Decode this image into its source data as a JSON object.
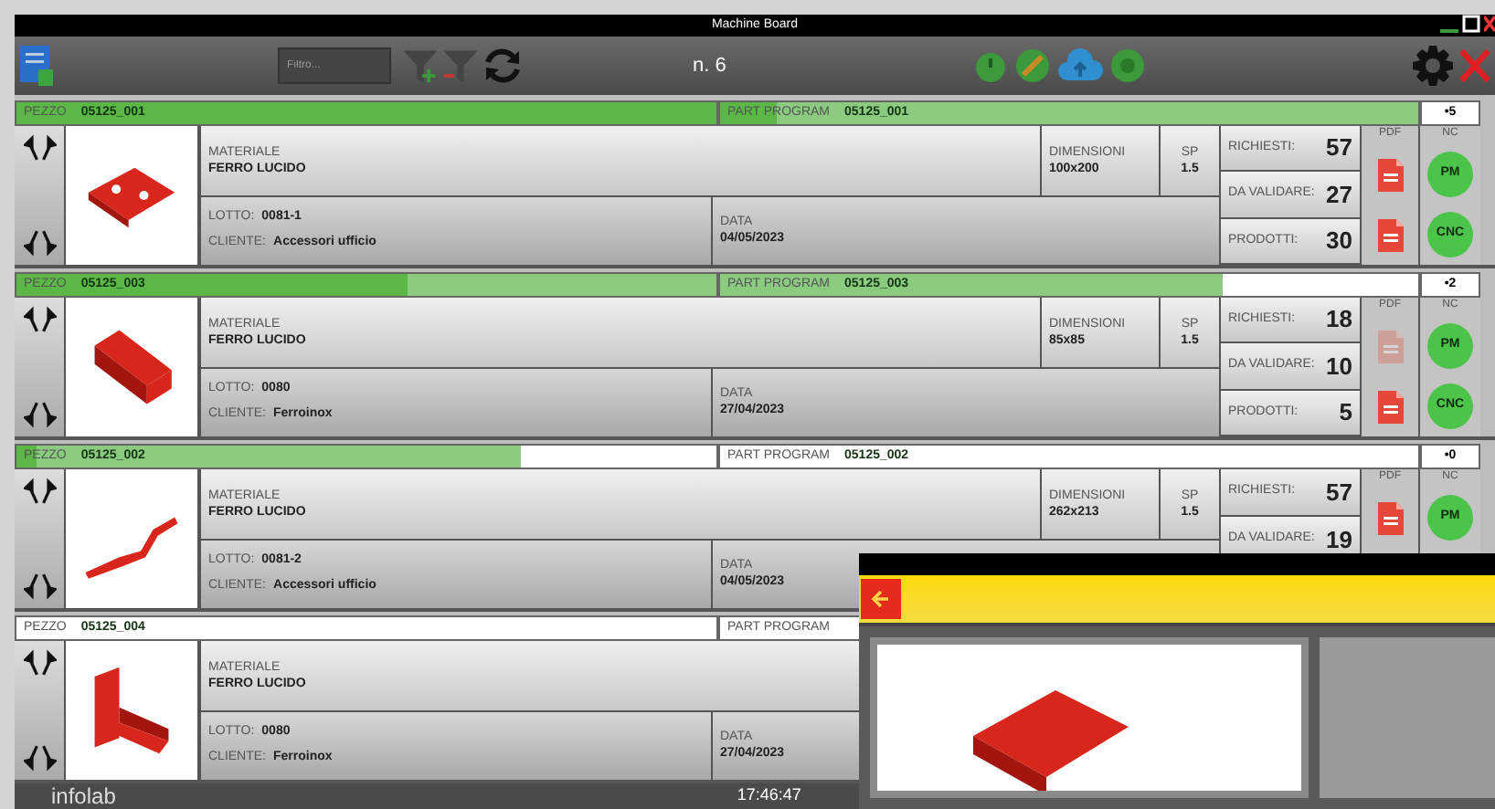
{
  "window": {
    "title": "Machine Board"
  },
  "toolbar": {
    "search": {
      "placeholder": "Filtro..."
    },
    "count": "n. 6"
  },
  "cards": [
    {
      "pezzo": {
        "label": "PEZZO",
        "code": "05125_001",
        "level": 1,
        "inner": {
          "level": 1
        }
      },
      "program": {
        "label": "PART PROGRAM",
        "code": "05125_001",
        "level": 1,
        "inner": {
          "level": 0.08
        }
      },
      "counter": "•5",
      "part": {
        "kind": "plate"
      },
      "materiale": {
        "label": "MATERIALE",
        "value": "FERRO LUCIDO"
      },
      "lotto": {
        "label": "LOTTO:",
        "value": "0081-1"
      },
      "cliente": {
        "label": "CLIENTE:",
        "value": "Accessori ufficio"
      },
      "data": {
        "label": "DATA",
        "value": "04/05/2023"
      },
      "dimensioni": {
        "label": "DIMENSIONI",
        "value": "100x200"
      },
      "sp": {
        "label": "SP",
        "value": "1.5"
      },
      "counts": [
        {
          "label": "RICHIESTI:",
          "value": "57"
        },
        {
          "label": "DA VALIDARE:",
          "value": "27"
        },
        {
          "label": "PRODOTTI:",
          "value": "30"
        }
      ],
      "pdf": {
        "label": "PDF",
        "files": [
          {
            "disabled": false
          },
          {
            "disabled": false
          }
        ]
      },
      "nc": {
        "label": "NC",
        "buttons": [
          "PM",
          "CNC"
        ]
      }
    },
    {
      "pezzo": {
        "label": "PEZZO",
        "code": "05125_003",
        "level": 1,
        "inner": {
          "level": 0.56
        }
      },
      "program": {
        "label": "PART PROGRAM",
        "code": "05125_003",
        "level": 0.72,
        "inner": {
          "level": 0
        }
      },
      "counter": "•2",
      "part": {
        "kind": "channel"
      },
      "materiale": {
        "label": "MATERIALE",
        "value": "FERRO LUCIDO"
      },
      "lotto": {
        "label": "LOTTO:",
        "value": "0080"
      },
      "cliente": {
        "label": "CLIENTE:",
        "value": "Ferroinox"
      },
      "data": {
        "label": "DATA",
        "value": "27/04/2023"
      },
      "dimensioni": {
        "label": "DIMENSIONI",
        "value": "85x85"
      },
      "sp": {
        "label": "SP",
        "value": "1.5"
      },
      "counts": [
        {
          "label": "RICHIESTI:",
          "value": "18"
        },
        {
          "label": "DA VALIDARE:",
          "value": "10"
        },
        {
          "label": "PRODOTTI:",
          "value": "5"
        }
      ],
      "pdf": {
        "label": "PDF",
        "files": [
          {
            "disabled": true
          },
          {
            "disabled": false
          }
        ]
      },
      "nc": {
        "label": "NC",
        "buttons": [
          "PM",
          "CNC"
        ]
      }
    },
    {
      "pezzo": {
        "label": "PEZZO",
        "code": "05125_002",
        "level": 0.72,
        "inner": {
          "level": 0.03
        }
      },
      "program": {
        "label": "PART PROGRAM",
        "code": "05125_002",
        "level": 0,
        "inner": {
          "level": 0
        }
      },
      "counter": "•0",
      "part": {
        "kind": "strip"
      },
      "materiale": {
        "label": "MATERIALE",
        "value": "FERRO LUCIDO"
      },
      "lotto": {
        "label": "LOTTO:",
        "value": "0081-2"
      },
      "cliente": {
        "label": "CLIENTE:",
        "value": "Accessori ufficio"
      },
      "data": {
        "label": "DATA",
        "value": "04/05/2023"
      },
      "dimensioni": {
        "label": "DIMENSIONI",
        "value": "262x213"
      },
      "sp": {
        "label": "SP",
        "value": "1.5"
      },
      "counts": [
        {
          "label": "RICHIESTI:",
          "value": "57"
        },
        {
          "label": "DA VALIDARE:",
          "value": "19"
        }
      ],
      "pdf": {
        "label": "PDF",
        "files": [
          {
            "disabled": false
          }
        ]
      },
      "nc": {
        "label": "NC",
        "buttons": [
          "PM"
        ]
      }
    },
    {
      "pezzo": {
        "label": "PEZZO",
        "code": "05125_004",
        "level": 0,
        "inner": {
          "level": 0
        }
      },
      "program": {
        "label": "PART PROGRAM",
        "level": 0,
        "inner": {
          "level": 0
        }
      },
      "part": {
        "kind": "bracket"
      },
      "materiale": {
        "label": "MATERIALE",
        "value": "FERRO LUCIDO"
      },
      "lotto": {
        "label": "LOTTO:",
        "value": "0080"
      },
      "cliente": {
        "label": "CLIENTE:",
        "value": "Ferroinox"
      },
      "data": {
        "label": "DATA",
        "value": "27/04/2023"
      }
    }
  ],
  "footer": {
    "logo": "infolab",
    "time": "17:46:47"
  },
  "dialog": {
    "part": {
      "kind": "basket"
    }
  }
}
